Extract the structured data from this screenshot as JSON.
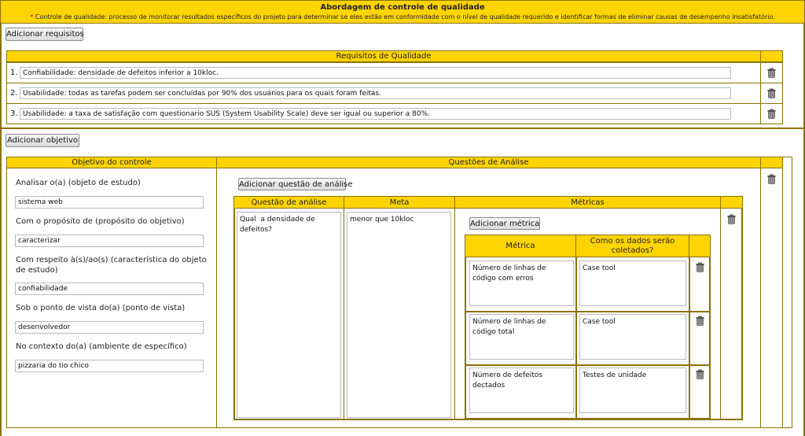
{
  "header": {
    "title": "Abordagem de controle de qualidade",
    "asterisk": "*",
    "subtitle": "Controle de qualidade: processo de monitorar resultados específicos do projeto para determinar se eles estão em conformidade com o nível de qualidade requerido e identificar formas de eliminar causas de desempenho insatisfatório."
  },
  "requirements": {
    "add_button": "Adicionar requisitos",
    "table_header": "Requisitos de Qualidade",
    "items": [
      {
        "number": "1.",
        "value": "Confiabilidade: densidade de defeitos inferior a 10kloc."
      },
      {
        "number": "2.",
        "value": "Usabilidade: todas as tarefas podem ser concluídas por 90% dos usuários para os quais foram feitas."
      },
      {
        "number": "3.",
        "value": "Usabilidade: a taxa de satisfação com questionario SUS (System Usability Scale) deve ser igual ou superior a 80%."
      }
    ]
  },
  "objective": {
    "add_button": "Adicionar objetivo",
    "header": "Objetivo do controle",
    "fields": [
      {
        "label": "Analisar o(a) (objeto de estudo)",
        "value": "sistema web"
      },
      {
        "label": "Com o propósito de (propósito do objetivo)",
        "value": "caracterizar"
      },
      {
        "label": "Com respeito à(s)/ao(s) (característica do objeto de estudo)",
        "value": "confiabilidade"
      },
      {
        "label": "Sob o ponto de vista do(a) (ponto de vista)",
        "value": "desenvolvedor"
      },
      {
        "label": "No contexto do(a) (ambiente de específico)",
        "value": "pizzaria do tio chico"
      }
    ]
  },
  "analysis": {
    "header": "Questões de Análise",
    "add_question_button": "Adicionar questão de análise",
    "columns": {
      "question": "Questão de análise",
      "goal": "Meta",
      "metrics": "Métricas"
    },
    "question": "Qual  a densidade de defeitos?",
    "goal": "menor que 10kloc",
    "add_metric_button": "Adicionar métrica",
    "metric_columns": {
      "metric": "Métrica",
      "collection": "Como os dados serão coletados?"
    },
    "metrics": [
      {
        "metric": "Número de linhas de código com erros",
        "collection": "Case tool"
      },
      {
        "metric": "Número de linhas de código total",
        "collection": "Case tool"
      },
      {
        "metric": "Número de defeitos dectados",
        "collection": "Testes de unidade"
      }
    ]
  },
  "icons": {
    "delete": "trash-icon"
  },
  "colors": {
    "header_bg": "#ffd400",
    "border": "#8b7200"
  }
}
